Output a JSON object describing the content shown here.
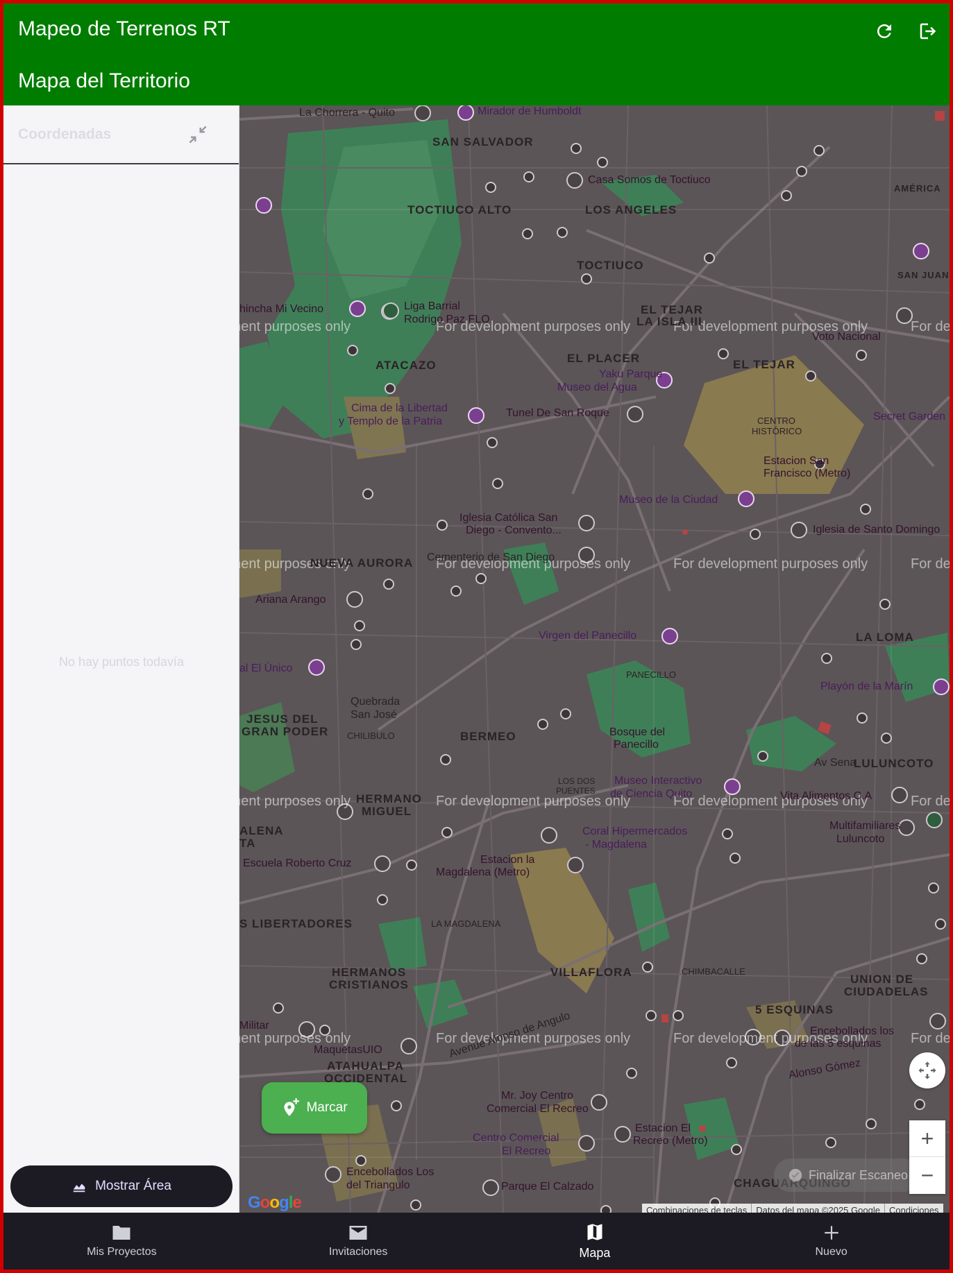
{
  "appbar": {
    "app_title": "Mapeo de Terrenos RT",
    "screen_title": "Mapa del Territorio",
    "refresh_icon": "refresh-icon",
    "logout_icon": "logout-icon",
    "color": "#007c00"
  },
  "side_panel": {
    "title": "Coordenadas",
    "collapse_icon": "collapse-icon",
    "empty_message": "No hay puntos todavía",
    "area_button_label": "Mostrar Área"
  },
  "map": {
    "watermark": "For development purposes only",
    "labels": {
      "chorrera": "La Chorrera - Quito",
      "mirador": "Mirador de Humboldt",
      "san_salvador": "SAN SALVADOR",
      "casa_somos": "Casa Somos de Toctiuco",
      "toctiuco_alto": "TOCTIUCO ALTO",
      "los_angeles": "LOS ANGELES",
      "toctiuco": "TOCTIUCO",
      "america": "AMÉRICA",
      "san_juan": "SAN JUAN",
      "liga_barrial": "Liga Barrial",
      "rodrigo": "Rodrigo Paz FLO",
      "chincha": "hincha Mi Vecino",
      "el_tejar_isla": "EL TEJAR",
      "la_isla": "LA ISLA III",
      "atacazo": "ATACAZO",
      "el_placer": "EL PLACER",
      "el_tejar": "EL TEJAR",
      "yaku": "Yaku Parque",
      "museo_agua": "Museo del Agua",
      "voto": "Voto Nacional",
      "cima": "Cima de la Libertad",
      "templo": "y Templo de la Patria",
      "tunel": "Tunel De San Roque",
      "centro": "CENTRO",
      "historico": "HISTÓRICO",
      "secret": "Secret Garden",
      "estacion_sf": "Estacion San",
      "francisco": "Francisco (Metro)",
      "museo_ciudad": "Museo de la Ciudad",
      "iglesia_sd": "Iglesia Católica San",
      "diego": "Diego - Convento...",
      "iglesia_sdo": "Iglesia de Santo Domingo",
      "cementerio": "Cementerio de San Diego",
      "nueva_aurora": "NUEVA AURORA",
      "ariana": "Ariana Arango",
      "virgen": "Virgen del Panecillo",
      "la_loma": "LA LOMA",
      "panecillo": "PANECILLO",
      "el_unico": "al El Único",
      "playon": "Playón de la Marín",
      "quebrada": "Quebrada",
      "san_jose": "San José",
      "jesus": "JESUS DEL",
      "gran_poder": "GRAN PODER",
      "chilibulo": "CHILIBULO",
      "bermeo": "BERMEO",
      "bosque": "Bosque del",
      "panecillo2": "Panecillo",
      "av_sena": "Av Sena",
      "lulunco": "LULUNCOTO",
      "los_dos": "LOS DOS",
      "puentes": "PUENTES",
      "museo_int": "Museo Interactivo",
      "ciencia": "de Ciencia Quito",
      "vita": "Vita Alimentos C.A",
      "hermano": "HERMANO",
      "miguel": "MIGUEL",
      "alena": "ALENA",
      "ta": "TA",
      "coral": "Coral Hipermercados",
      "magdalena": "- Magdalena",
      "multifam": "Multifamiliares",
      "multifam2": "Luluncoto",
      "escuela": "Escuela Roberto Cruz",
      "estacion_lm": "Estacion la",
      "magdalena_metro": "Magdalena (Metro)",
      "libertadores": "S LIBERTADORES",
      "la_magdalena": "LA MAGDALENA",
      "hermanos": "HERMANOS",
      "cristianos": "CRISTIANOS",
      "villaflora": "VILLAFLORA",
      "chimbacalle": "CHIMBACALLE",
      "union": "UNION DE",
      "ciudadelas": "CIUDADELAS",
      "cinco_esq": "5 ESQUINAS",
      "encebollados": "Encebollados los",
      "esquinas": "de las 5 esquinas",
      "militar": "Militar",
      "maquetas": "MaquetasUIO",
      "atahualpa": "ATAHUALPA",
      "occidental": "OCCIDENTAL",
      "alonso": "Avenue Alonso de Angulo",
      "mr_joy": "Mr. Joy Centro",
      "recreo": "Comercial El Recreo",
      "cc_recreo": "Centro Comercial",
      "el_recreo": "El Recreo",
      "estacion_er": "Estacion El",
      "recreo_metro": "Recreo (Metro)",
      "enceb_tri": "Encebollados Los",
      "triangulo": "del Triangulo",
      "parque_calzado": "Parque El Calzado",
      "chaguarquingo": "CHAGUARQUINGO",
      "alonso_gomez": "Alonso Gómez"
    },
    "marcar_label": "Marcar",
    "marcar_icon": "add-location-icon",
    "scan_label": "Finalizar Escaneo",
    "fullscreen_icon": "fullscreen-icon",
    "zoom_in": "+",
    "zoom_out": "−",
    "google_logo": "Google",
    "attribution": {
      "shortcuts": "Combinaciones de teclas",
      "map_data": "Datos del mapa ©2025 Google",
      "terms": "Condiciones"
    }
  },
  "bottom_nav": {
    "items": [
      {
        "label": "Mis Proyectos",
        "icon": "folder-icon"
      },
      {
        "label": "Invitaciones",
        "icon": "mail-icon"
      },
      {
        "label": "Mapa",
        "icon": "map-icon"
      },
      {
        "label": "Nuevo",
        "icon": "plus-icon"
      }
    ],
    "active": "Mapa"
  }
}
